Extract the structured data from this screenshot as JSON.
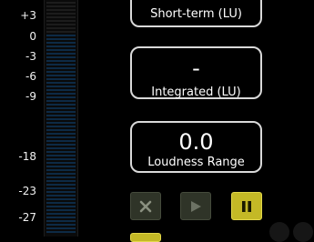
{
  "scale": {
    "labels": [
      "+3",
      "0",
      "-3",
      "-6",
      "-9",
      "-18",
      "-23",
      "-27"
    ]
  },
  "readouts": {
    "short_term": {
      "label": "Short-term (LU)"
    },
    "integrated": {
      "value": "-",
      "label": "Integrated (LU)"
    },
    "loudness_range": {
      "value": "0.0",
      "label": "Loudness Range"
    }
  },
  "transport": {
    "reset_icon": "close-icon",
    "play_icon": "play-icon",
    "pause_icon": "pause-icon"
  },
  "colors": {
    "background": "#000000",
    "meter_segment": "#0d2a45",
    "meter_segment_upper": "#1c1c1c",
    "box_border": "#d9d9d9",
    "button_dim": "#2f3428",
    "button_active": "#c4b926"
  }
}
